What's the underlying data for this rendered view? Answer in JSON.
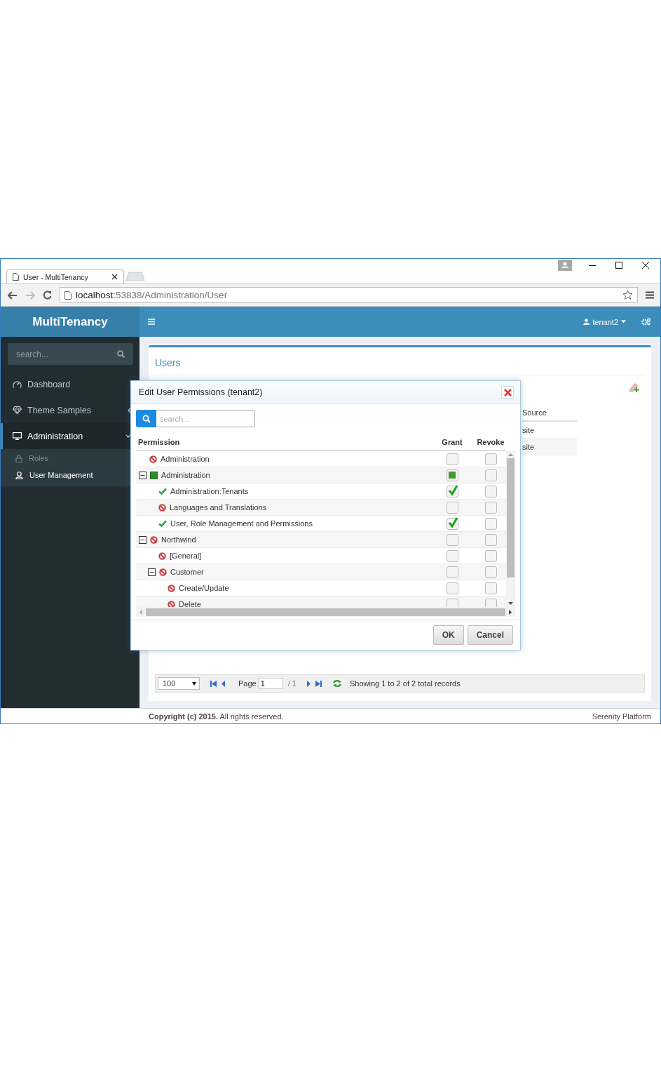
{
  "browser": {
    "tab_title": "User - MultiTenancy",
    "url_host": "localhost",
    "url_path": ":53838/Administration/User"
  },
  "header": {
    "brand": "MultiTenancy",
    "user": "tenant2"
  },
  "sidebar": {
    "search_placeholder": "search...",
    "items": [
      {
        "label": "Dashboard",
        "kind": "link",
        "selected": false
      },
      {
        "label": "Theme Samples",
        "kind": "group",
        "selected": false,
        "expanded": false
      },
      {
        "label": "Administration",
        "kind": "group",
        "selected": true,
        "expanded": true,
        "children": [
          {
            "label": "Roles",
            "selected": false
          },
          {
            "label": "User Management",
            "selected": true
          }
        ]
      }
    ]
  },
  "page": {
    "title": "Users",
    "grid": {
      "column": "Source",
      "rows": [
        "site",
        "site"
      ]
    },
    "pager": {
      "page_size": "100",
      "page_label": "Page",
      "page": "1",
      "page_total": "/ 1",
      "status": "Showing 1 to 2 of 2 total records"
    }
  },
  "footer": {
    "copyright": "**Copyright (c) 2015.** All rights reserved.",
    "platform": "Serenity Platform"
  },
  "dialog": {
    "title": "Edit User Permissions (tenant2)",
    "search_placeholder": "search...",
    "columns": [
      "Permission",
      "Grant",
      "Revoke"
    ],
    "rows": [
      {
        "label": "Administration",
        "checked": false,
        "partial": false,
        "revoke": false
      },
      {
        "label": "Administration",
        "checked": false,
        "partial": true,
        "revoke": false,
        "expanded": true,
        "children": [
          {
            "label": "Administration:Tenants",
            "checked": true,
            "partial": false,
            "revoke": false
          },
          {
            "label": "Languages and Translations",
            "checked": false,
            "partial": false,
            "revoke": false
          },
          {
            "label": "User, Role Management and Permissions",
            "checked": true,
            "partial": false,
            "revoke": false
          }
        ]
      },
      {
        "label": "Northwind",
        "checked": false,
        "partial": false,
        "revoke": false,
        "expanded": true,
        "children": [
          {
            "label": "[General]",
            "checked": false,
            "partial": false,
            "revoke": false
          },
          {
            "label": "Customer",
            "checked": false,
            "partial": false,
            "revoke": false,
            "expanded": true,
            "children": [
              {
                "label": "Create/Update",
                "checked": false,
                "partial": false,
                "revoke": false
              },
              {
                "label": "Delete",
                "checked": false,
                "partial": false,
                "revoke": false
              }
            ]
          }
        ]
      }
    ],
    "buttons": [
      "OK",
      "Cancel"
    ]
  }
}
